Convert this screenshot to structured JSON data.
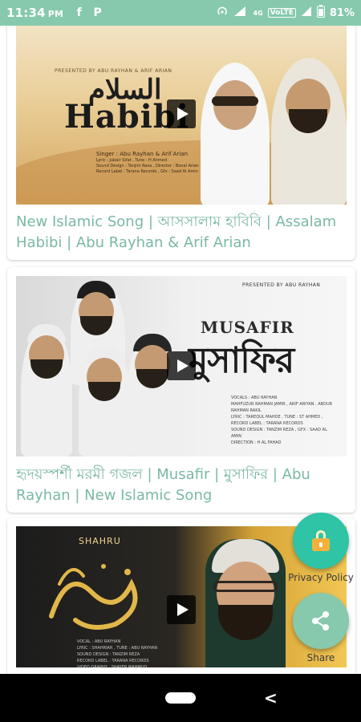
{
  "status_bar": {
    "time": "11:34",
    "time_suffix": "PM",
    "app_icons": [
      "facebook-icon",
      "p-icon"
    ],
    "facebook_glyph": "f",
    "p_glyph": "P",
    "network_label": "4G",
    "volte_label": "VoLTE",
    "battery": "81%"
  },
  "videos": [
    {
      "title": "New Islamic Song | আসসালাম হাবিবি | Assalam Habibi | Abu Rayhan & Arif Arian",
      "thumb": {
        "presented": "PRESENTED BY ABU RAYHAN & ARIF ARIAN",
        "arabic": "السلام",
        "title": "Habibi",
        "singer_line": "Singer : Abu Rayhan & Arif Arian",
        "credits": "Lyric : Jubair Sifat , Tune : H Ahmed\nSound Design : Tanjim Reza , Director : Bonal Arian\nRecord Label : Tarana Records , Gfx : Saad Al Amin"
      }
    },
    {
      "title": "হৃদয়স্পর্শী মরমী গজল | Musafir | মুসাফির | Abu Rayhan | New Islamic Song",
      "thumb": {
        "presented": "PRESENTED BY ABU RAYHAN",
        "title_en": "MUSAFIR",
        "title_bn": "মুসাফির",
        "credits": "VOCALS : ABU RAYHAN\nMAHFUZUR RAHMAN JAMIR , ARIF ARIYAN , ABDUR RAHMAN RAKIL\nLYRIC : TAREQUL MAHDE , TUNE : ST AHMED , RECORD LABEL : TARANA RECORDS\nSOUND DESIGN : TANZIM REZA , GFX : SAAD AL AMIN\nDIRECTION : H AL FAHAD"
      }
    },
    {
      "title": "",
      "thumb": {
        "heading": "SHAHRU",
        "calligraphy": "رمضان",
        "credits": "VOCAL : ABU RAYHAN\nLYRIC : SHAHRIAR , TUNE : ABU RAYHAN\nSOUND DESIGN : TANZIM REZA\nRECORD LABEL : TARANA RECORDS\nVIDEO GRAPHY : SHAYER MAHMUD"
      }
    }
  ],
  "fab": {
    "privacy_label": "Privacy Policy",
    "share_label": "Share"
  },
  "colors": {
    "accent": "#86c9ad",
    "caption": "#7ab9a1",
    "privacy_fab": "#2ec4a5"
  },
  "nav": {
    "back_glyph": "<"
  }
}
